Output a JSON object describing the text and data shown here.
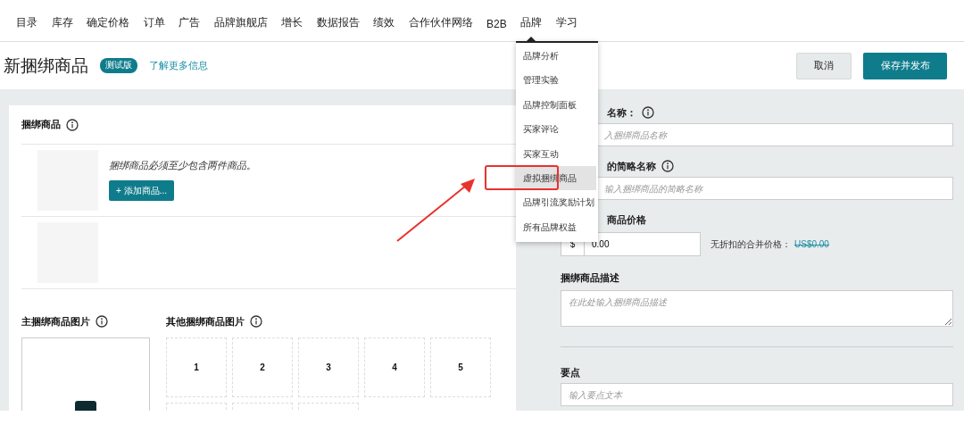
{
  "nav": {
    "items": [
      {
        "label": "目录",
        "selected": false
      },
      {
        "label": "库存",
        "selected": false
      },
      {
        "label": "确定价格",
        "selected": false
      },
      {
        "label": "订单",
        "selected": false
      },
      {
        "label": "广告",
        "selected": false
      },
      {
        "label": "品牌旗舰店",
        "selected": false
      },
      {
        "label": "增长",
        "selected": false
      },
      {
        "label": "数据报告",
        "selected": false
      },
      {
        "label": "绩效",
        "selected": false
      },
      {
        "label": "合作伙伴网络",
        "selected": false
      },
      {
        "label": "B2B",
        "selected": false
      },
      {
        "label": "品牌",
        "selected": true
      },
      {
        "label": "学习",
        "selected": false
      }
    ]
  },
  "dropdown": {
    "items": [
      {
        "label": "品牌分析",
        "selected": false
      },
      {
        "label": "管理实验",
        "selected": false
      },
      {
        "label": "品牌控制面板",
        "selected": false
      },
      {
        "label": "买家评论",
        "selected": false
      },
      {
        "label": "买家互动",
        "selected": false
      },
      {
        "label": "虚拟捆绑商品",
        "selected": true
      },
      {
        "label": "品牌引流奖励计划",
        "selected": false
      },
      {
        "label": "所有品牌权益",
        "selected": false
      }
    ]
  },
  "header": {
    "title": "新捆绑商品",
    "badge": "测试版",
    "link": "了解更多信息",
    "buttons": [
      {
        "label": "取消",
        "kind": "secondary"
      },
      {
        "label": "保存并发布",
        "kind": "primary"
      }
    ]
  },
  "bundle": {
    "title": "捆绑商品",
    "note": "捆绑商品必须至少包含两件商品。",
    "add_button": "+ 添加商品..."
  },
  "images": {
    "main_label": "主捆绑商品图片",
    "other_label": "其他捆绑商品图片",
    "slots": [
      "1",
      "2",
      "3",
      "4",
      "5"
    ]
  },
  "form": {
    "name_label": "名称：",
    "name_placeholder": "入捆绑商品名称",
    "short_label": "的简略名称",
    "short_placeholder": "输入捆绑商品的简略名称",
    "price_label": "商品价格",
    "currency": "$",
    "price_value": "0.00",
    "combined_label": "无折扣的合并价格：",
    "combined_value": "US$0.00",
    "desc_label": "捆绑商品描述",
    "desc_placeholder": "在此处输入捆绑商品描述",
    "points_label": "要点",
    "points_placeholder": "输入要点文本"
  }
}
